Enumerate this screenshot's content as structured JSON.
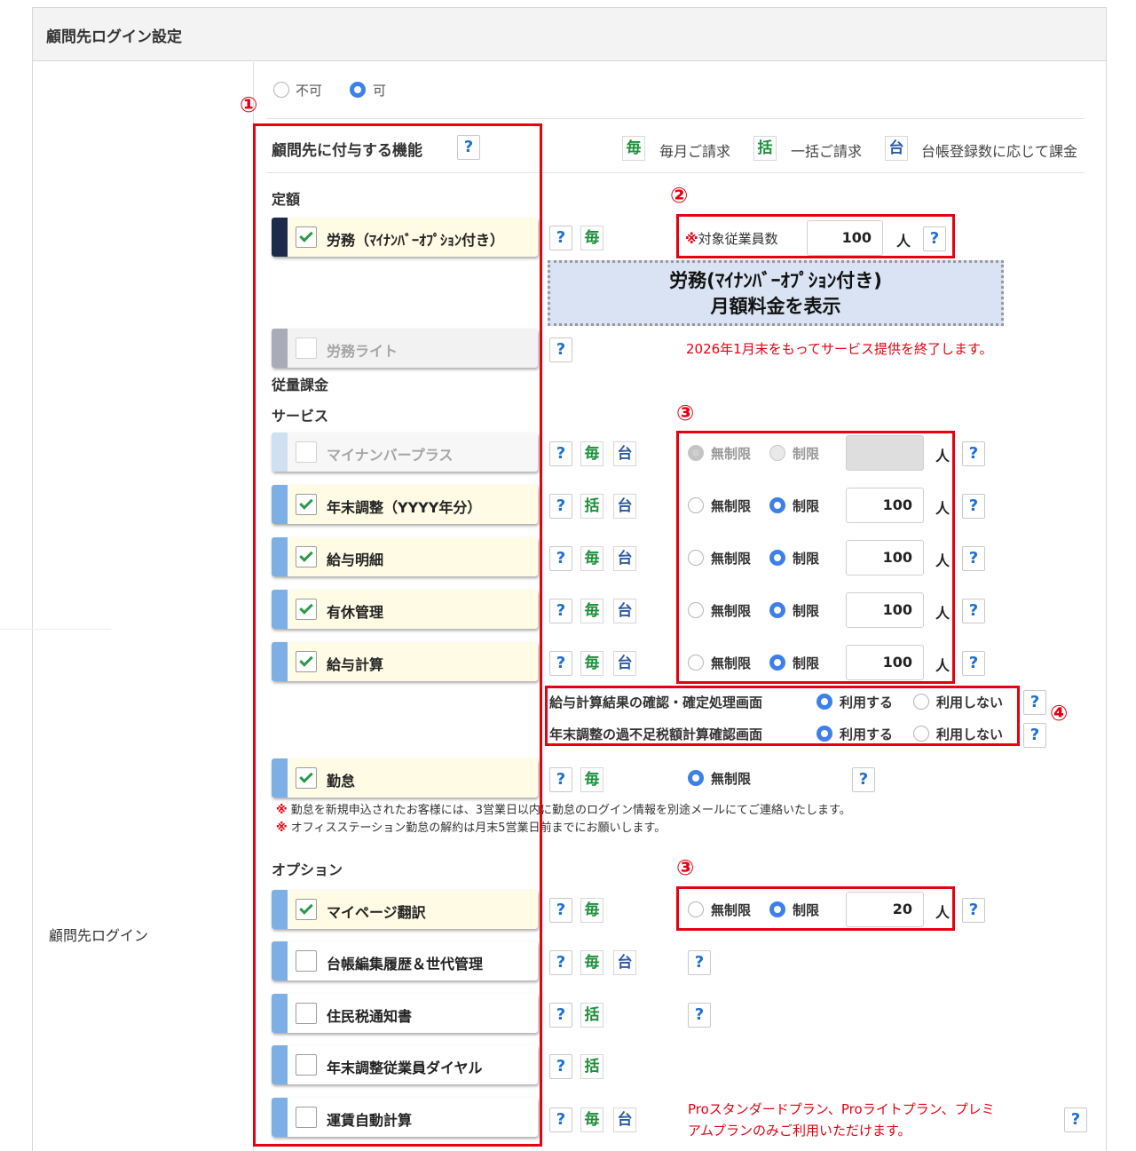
{
  "panel": {
    "title": "顧問先ログイン設定",
    "row_label": "顧問先ログイン"
  },
  "access": {
    "options": [
      "不可",
      "可"
    ],
    "selected": "可"
  },
  "functions": {
    "heading": "顧問先に付与する機能",
    "legend": [
      {
        "badge": "毎",
        "text": "毎月ご請求"
      },
      {
        "badge": "括",
        "text": "一括ご請求"
      },
      {
        "badge": "台",
        "text": "台帳登録数に応じて課金"
      }
    ],
    "help": "?"
  },
  "sections": {
    "fixed": "定額",
    "usage": "従量課金",
    "services": "サービス",
    "options": "オプション"
  },
  "fixed_items": {
    "roumu": {
      "label": "労務（ﾏｲﾅﾝﾊﾞｰｵﾌﾟｼｮﾝ付き）",
      "checked": true,
      "badges": [
        "毎"
      ]
    },
    "roumu_lite": {
      "label": "労務ライト",
      "checked": false,
      "disabled": true,
      "notice": "2026年1月末をもってサービス提供を終了します。"
    }
  },
  "employee_count": {
    "prefix": "※",
    "label": "対象従業員数",
    "value": "100",
    "unit": "人"
  },
  "monthly_fee_box": {
    "line1": "労務(ﾏｲﾅﾝﾊﾞｰｵﾌﾟｼｮﾝ付き)",
    "line2": "月額料金を表示"
  },
  "service_items": [
    {
      "label": "マイナンバープラス",
      "checked": false,
      "disabled": true,
      "badges": [
        "毎",
        "台"
      ],
      "limit": "無制限",
      "value": "",
      "unit": "人"
    },
    {
      "label": "年末調整（YYYY年分）",
      "checked": true,
      "badges": [
        "括",
        "台"
      ],
      "limit": "制限",
      "value": "100",
      "unit": "人"
    },
    {
      "label": "給与明細",
      "checked": true,
      "badges": [
        "毎",
        "台"
      ],
      "limit": "制限",
      "value": "100",
      "unit": "人"
    },
    {
      "label": "有休管理",
      "checked": true,
      "badges": [
        "毎",
        "台"
      ],
      "limit": "制限",
      "value": "100",
      "unit": "人"
    },
    {
      "label": "給与計算",
      "checked": true,
      "badges": [
        "毎",
        "台"
      ],
      "limit": "制限",
      "value": "100",
      "unit": "人"
    }
  ],
  "limit_labels": {
    "unlimited": "無制限",
    "limited": "制限"
  },
  "screen_options": [
    {
      "label": "給与計算結果の確認・確定処理画面",
      "use": "利用する",
      "no_use": "利用しない",
      "selected": "利用する"
    },
    {
      "label": "年末調整の過不足税額計算確認画面",
      "use": "利用する",
      "no_use": "利用しない",
      "selected": "利用する"
    }
  ],
  "kintai": {
    "label": "勤怠",
    "checked": true,
    "badges": [
      "毎"
    ],
    "limit": "無制限",
    "notes": [
      "勤怠を新規申込されたお客様には、3営業日以内に勤怠のログイン情報を別途メールにてご連絡いたします。",
      "オフィスステーション勤怠の解約は月末5営業日前までにお願いします。"
    ],
    "note_mark": "※"
  },
  "option_items": [
    {
      "label": "マイページ翻訳",
      "checked": true,
      "badges": [
        "毎"
      ],
      "limit": "制限",
      "value": "20",
      "unit": "人"
    },
    {
      "label": "台帳編集履歴＆世代管理",
      "checked": false,
      "badges": [
        "毎",
        "台"
      ]
    },
    {
      "label": "住民税通知書",
      "checked": false,
      "badges": [
        "括"
      ]
    },
    {
      "label": "年末調整従業員ダイヤル",
      "checked": false,
      "badges": [
        "括"
      ]
    },
    {
      "label": "運賃自動計算",
      "checked": false,
      "badges": [
        "毎",
        "台"
      ],
      "notice": "Proスタンダードプラン、Proライトプラン、プレミアムプランのみご利用いただけます。",
      "notice_line1": "Proスタンダードプラン、Proライトプラン、プレミ",
      "notice_line2": "アムプランのみご利用いただけます。"
    }
  ],
  "annotations": {
    "a1": "①",
    "a2": "②",
    "a3": "③",
    "a4": "④"
  },
  "colors": {
    "annotation_red": "#e60012",
    "accent_blue": "#3d80ea",
    "monthly_green": "#1e8f3c",
    "ledger_blue": "#2b5aa5",
    "help_blue": "#1e6fd0",
    "selected_card": "#fffbe5",
    "card_bar": "#7cb0e4"
  }
}
